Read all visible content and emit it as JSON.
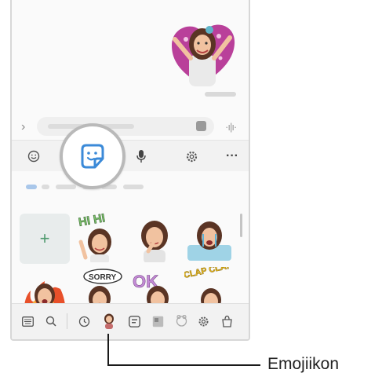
{
  "annotation": {
    "label": "Emojiikon"
  },
  "toolbar": {
    "buttons": [
      "emoji",
      "sticker",
      "voice",
      "settings",
      "more"
    ],
    "more_label": "···"
  },
  "input": {
    "chevron": "›",
    "voice_wave": "·ı|ı·"
  },
  "sticker_panel": {
    "add_label": "+",
    "sticker_texts": [
      "HI HI",
      "SORRY",
      "OK",
      "CLAP CLAP"
    ]
  },
  "bottom_bar": {
    "icons": [
      "keyboard-icon",
      "search-icon",
      "recent-icon",
      "emoji-avatar-icon",
      "sticker-pack-icon",
      "gif-icon",
      "bitmoji-icon",
      "settings-icon",
      "shop-icon"
    ]
  },
  "colors": {
    "accent": "#3b8ad8",
    "add": "#4f9a6e"
  }
}
